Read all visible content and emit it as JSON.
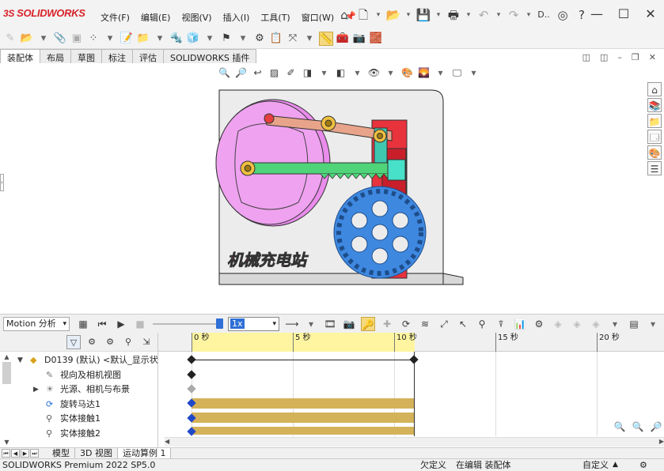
{
  "app": {
    "logo_prefix": "3S",
    "logo_text": "SOLIDWORKS"
  },
  "menu": [
    "文件(F)",
    "编辑(E)",
    "视图(V)",
    "插入(I)",
    "工具(T)",
    "窗口(W)"
  ],
  "title_toolbar": {
    "truncated_label": "D.."
  },
  "command_tabs": [
    "装配体",
    "布局",
    "草图",
    "标注",
    "评估",
    "SOLIDWORKS 插件"
  ],
  "model": {
    "title_text": "机械充电站",
    "colors": {
      "cam": "#e98cec",
      "gear": "#3f88e0",
      "rack": "#4fd47a",
      "link": "#e8a48a",
      "slider": "#e8323c",
      "base": "#ececec"
    }
  },
  "motion": {
    "study_type": "Motion 分析",
    "speed": "1x"
  },
  "timeline": {
    "ticks": [
      "0 秒",
      "5 秒",
      "10 秒",
      "15 秒",
      "20 秒"
    ]
  },
  "tree": {
    "items": [
      {
        "label": "D0139 (默认) <默认_显示状态",
        "icon": "assembly-icon",
        "expandable": true
      },
      {
        "label": "视向及相机视图",
        "icon": "camera-icon",
        "expandable": false
      },
      {
        "label": "光源、相机与布景",
        "icon": "lights-icon",
        "expandable": true
      },
      {
        "label": "旋转马达1",
        "icon": "motor-icon",
        "expandable": false
      },
      {
        "label": "实体接触1",
        "icon": "contact-icon",
        "expandable": false
      },
      {
        "label": "实体接触2",
        "icon": "contact-icon",
        "expandable": false
      }
    ]
  },
  "bottom_tabs": [
    "模型",
    "3D 视图",
    "运动算例 1"
  ],
  "status": {
    "version": "SOLIDWORKS Premium 2022 SP5.0",
    "constraint": "欠定义",
    "mode": "在编辑 装配体",
    "units": "自定义"
  }
}
